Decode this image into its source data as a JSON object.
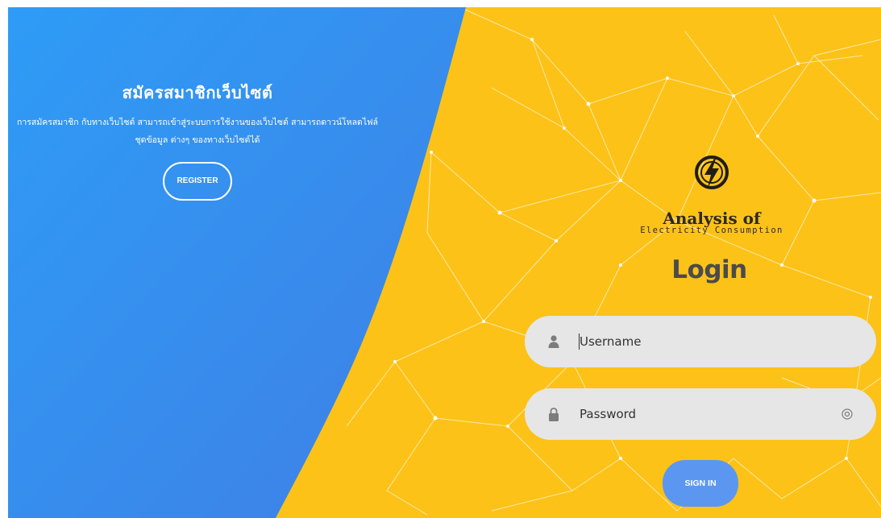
{
  "register": {
    "title": "สมัครสมาชิกเว็บไซต์",
    "description": "การสมัครสมาชิก กับทางเว็บไซต์ สามารถเข้าสู่ระบบการใช้งานของเว็บไซต์ สามารถดาวน์โหลดไฟล์ชุดข้อมูล ต่างๆ ของทางเว็บไซต์ได้",
    "button_label": "REGISTER"
  },
  "logo": {
    "icon": "lightning-bolt-icon",
    "title": "Analysis of",
    "subtitle": "Electricity Consumption"
  },
  "login": {
    "heading": "Login",
    "username_placeholder": "Username",
    "password_placeholder": "Password",
    "signin_label": "SIGN IN"
  },
  "icons": {
    "username": "user-icon",
    "password": "lock-icon",
    "password_toggle": "eye-icon"
  },
  "colors": {
    "left_panel_gradient_start": "#2e9bf5",
    "left_panel_gradient_end": "#3d82e6",
    "right_panel": "#fcc218",
    "input_background": "#e6e6e6",
    "signin_button": "#5b97f0",
    "heading_text": "#4b4b4b"
  }
}
